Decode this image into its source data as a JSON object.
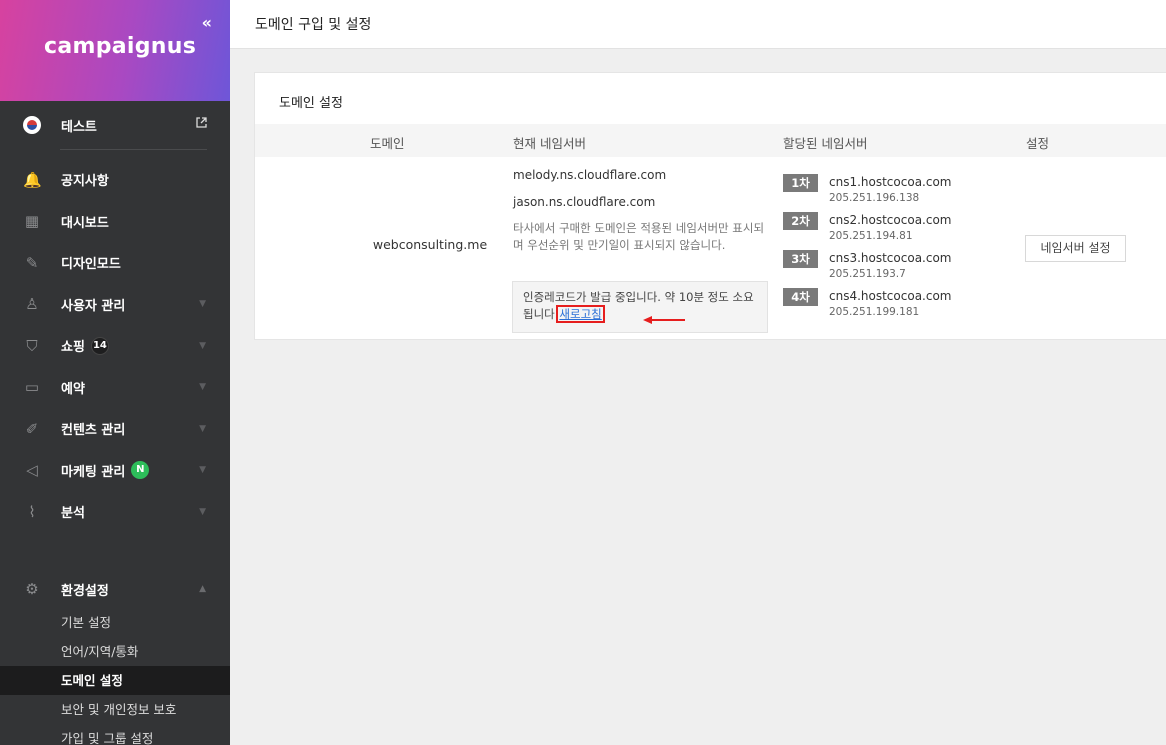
{
  "sidebar": {
    "logo": "campaignus",
    "collapse_glyph": "«",
    "site": {
      "name": "테스트",
      "icon": "kr-flag-icon",
      "ext_icon": "external-link-icon"
    },
    "menu": [
      {
        "label": "공지사항",
        "icon": "bell-icon",
        "glyph": "🔔",
        "has_chevron": false
      },
      {
        "label": "대시보드",
        "icon": "grid-icon",
        "glyph": "▦",
        "has_chevron": false
      },
      {
        "label": "디자인모드",
        "icon": "magic-wand-icon",
        "glyph": "✎",
        "has_chevron": false
      },
      {
        "label": "사용자 관리",
        "icon": "user-icon",
        "glyph": "♙",
        "has_chevron": true
      },
      {
        "label": "쇼핑",
        "icon": "shopping-bag-icon",
        "glyph": "⛉",
        "has_chevron": true,
        "badge": "14"
      },
      {
        "label": "예약",
        "icon": "calendar-icon",
        "glyph": "▭",
        "has_chevron": true
      },
      {
        "label": "컨텐츠 관리",
        "icon": "edit-icon",
        "glyph": "✐",
        "has_chevron": true
      },
      {
        "label": "마케팅 관리",
        "icon": "megaphone-icon",
        "glyph": "◁",
        "has_chevron": true,
        "badge": "N"
      },
      {
        "label": "분석",
        "icon": "chart-line-icon",
        "glyph": "⌇",
        "has_chevron": true
      }
    ],
    "settings": {
      "label": "환경설정",
      "icon": "gear-icon",
      "items": [
        "기본 설정",
        "언어/지역/통화",
        "도메인 설정",
        "보안 및 개인정보 보호",
        "가입 및 그룹 설정"
      ],
      "active_index": 2
    }
  },
  "header": {
    "title": "도메인 구입 및 설정"
  },
  "card": {
    "title": "도메인 설정",
    "columns": [
      "도메인",
      "현재 네임서버",
      "할당된 네임서버",
      "설정"
    ],
    "domain": "webconsulting.me",
    "current_ns": [
      "melody.ns.cloudflare.com",
      "jason.ns.cloudflare.com"
    ],
    "note": "타사에서 구매한 도메인은 적용된 네임서버만 표시되며 우선순위 및 만기일이 표시되지 않습니다.",
    "pending_msg": "인증레코드가 발급 중입니다. 약 10분 정도 소요됩니다.",
    "refresh_label": "새로고침",
    "assigned_ns": [
      {
        "tag": "1차",
        "host": "cns1.hostcocoa.com",
        "ip": "205.251.196.138"
      },
      {
        "tag": "2차",
        "host": "cns2.hostcocoa.com",
        "ip": "205.251.194.81"
      },
      {
        "tag": "3차",
        "host": "cns3.hostcocoa.com",
        "ip": "205.251.193.7"
      },
      {
        "tag": "4차",
        "host": "cns4.hostcocoa.com",
        "ip": "205.251.199.181"
      }
    ],
    "ns_button": "네임서버 설정"
  },
  "colors": {
    "accent_gradient": [
      "#d7429f",
      "#6e56d8"
    ],
    "sidebar_bg": "#333436",
    "link": "#2b6fd6",
    "highlight": "#e61e1e",
    "badge_green": "#2dbd5a"
  }
}
